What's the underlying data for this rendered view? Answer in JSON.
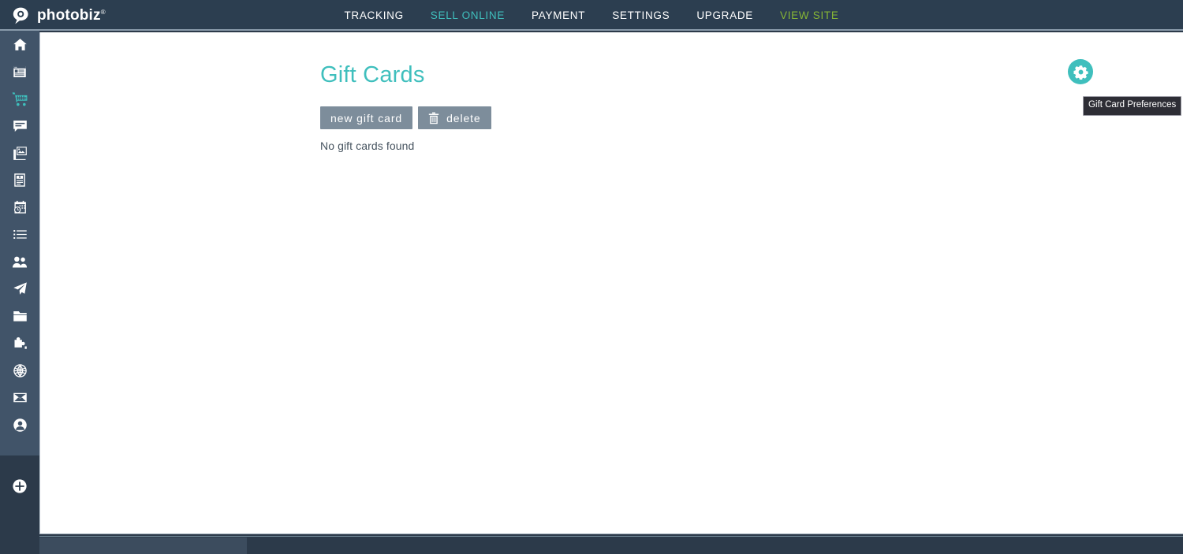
{
  "brand": {
    "name": "photobiz",
    "logo_icon": "speech-bubble-pin-logo-icon"
  },
  "topnav": {
    "items": [
      {
        "label": "TRACKING",
        "state": "default",
        "color": "#ffffff"
      },
      {
        "label": "SELL ONLINE",
        "state": "active",
        "color": "#3fbfbd"
      },
      {
        "label": "PAYMENT",
        "state": "default",
        "color": "#ffffff"
      },
      {
        "label": "SETTINGS",
        "state": "default",
        "color": "#ffffff"
      },
      {
        "label": "UPGRADE",
        "state": "default",
        "color": "#ffffff"
      },
      {
        "label": "VIEW SITE",
        "state": "external",
        "color": "#86b535"
      }
    ]
  },
  "sidebar": {
    "items": [
      {
        "name": "home",
        "icon": "home-icon",
        "active": false
      },
      {
        "name": "pages",
        "icon": "browser-window-icon",
        "active": false
      },
      {
        "name": "sell-online",
        "icon": "shopping-cart-icon",
        "active": true
      },
      {
        "name": "blog",
        "icon": "comment-bubble-icon",
        "active": false
      },
      {
        "name": "galleries",
        "icon": "images-icon",
        "active": false
      },
      {
        "name": "invoices",
        "icon": "invoice-dollar-icon",
        "active": false
      },
      {
        "name": "scheduling",
        "icon": "calendar-clock-icon",
        "active": false
      },
      {
        "name": "lists",
        "icon": "list-icon",
        "active": false
      },
      {
        "name": "contacts",
        "icon": "people-icon",
        "active": false
      },
      {
        "name": "marketing",
        "icon": "paper-plane-icon",
        "active": false
      },
      {
        "name": "files",
        "icon": "folder-icon",
        "active": false
      },
      {
        "name": "apps",
        "icon": "puzzle-piece-icon",
        "active": false
      },
      {
        "name": "domains",
        "icon": "globe-icon",
        "active": false
      },
      {
        "name": "email",
        "icon": "envelope-icon",
        "active": false
      },
      {
        "name": "account",
        "icon": "user-circle-icon",
        "active": false
      }
    ],
    "footer_items": [
      {
        "name": "add-new",
        "icon": "plus-circle-icon",
        "active": false
      }
    ]
  },
  "main": {
    "title": "Gift Cards",
    "buttons": [
      {
        "key": "new",
        "label": "new gift card",
        "icon": null
      },
      {
        "key": "delete",
        "label": "delete",
        "icon": "trash-icon"
      }
    ],
    "empty_message": "No gift cards found",
    "preferences": {
      "icon": "gear-icon",
      "tooltip": "Gift Card Preferences"
    }
  },
  "colors": {
    "header_bg": "#2c3e50",
    "sidebar_top_bg": "#415469",
    "sidebar_bottom_bg": "#2c3a4a",
    "accent_teal": "#3fbfbd",
    "view_site_green": "#86b535",
    "button_gray": "#7d8d9b",
    "text_dark": "#46535f",
    "tooltip_bg": "#2d2d35",
    "content_bg": "#ffffff"
  }
}
